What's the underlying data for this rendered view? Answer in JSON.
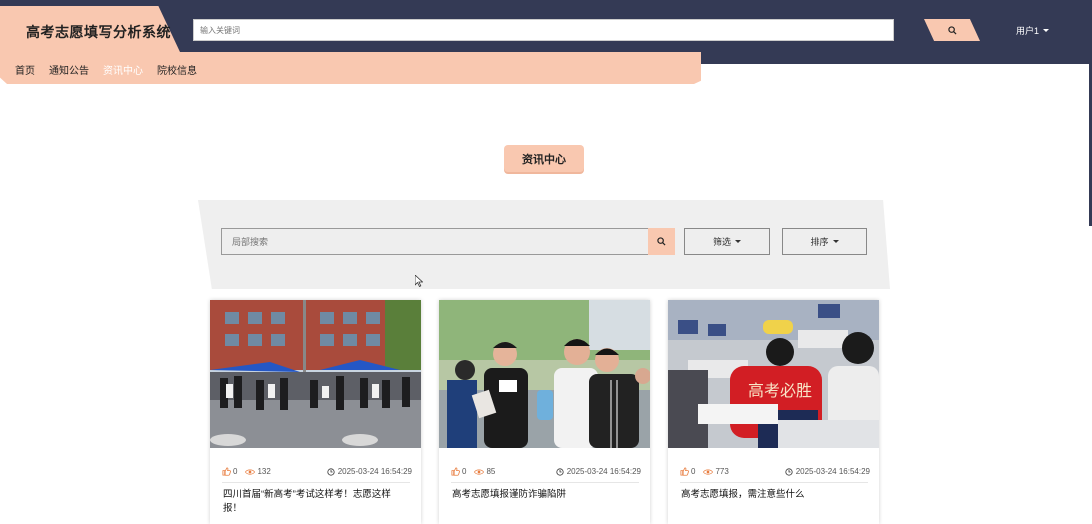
{
  "app": {
    "title": "高考志愿填写分析系统",
    "search_placeholder": "输入关键词",
    "user_label": "用户1"
  },
  "nav": {
    "items": [
      {
        "label": "首页"
      },
      {
        "label": "通知公告"
      },
      {
        "label": "资讯中心"
      },
      {
        "label": "院校信息"
      }
    ],
    "active_index": 2
  },
  "page": {
    "section_title": "资讯中心",
    "local_search_placeholder": "局部搜索",
    "filter_label": "筛选",
    "sort_label": "排序"
  },
  "articles": [
    {
      "likes": "0",
      "views": "132",
      "time": "2025-03-24 16:54:29",
      "title": "四川首届“新高考”考试这样考！志愿这样报！",
      "image": "campus-exam-gate-photo"
    },
    {
      "likes": "0",
      "views": "85",
      "time": "2025-03-24 16:54:29",
      "title": "高考志愿填报谨防诈骗陷阱",
      "image": "students-smiling-photo"
    },
    {
      "likes": "0",
      "views": "773",
      "time": "2025-03-24 16:54:29",
      "title": "高考志愿填报，需注意些什么",
      "image": "exam-hall-photo"
    }
  ],
  "icons": {
    "search": "search-icon",
    "like": "thumbs-up-icon",
    "view": "eye-icon",
    "time": "clock-icon",
    "caret": "caret-down-icon"
  },
  "colors": {
    "header_bg": "#343a55",
    "accent": "#f9c8b0",
    "like_icon": "#e87c3e",
    "panel_bg": "#efefef"
  }
}
